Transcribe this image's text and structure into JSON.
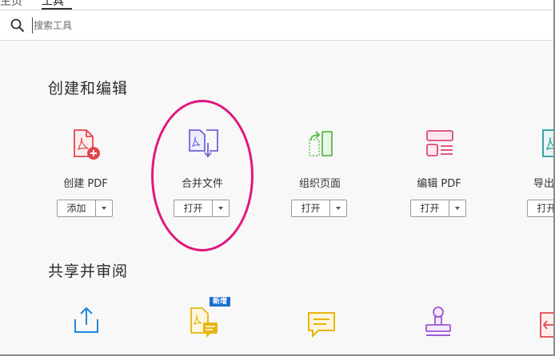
{
  "tabs": [
    {
      "label": "主页"
    },
    {
      "label": "工具"
    }
  ],
  "search": {
    "placeholder": "搜索工具"
  },
  "sections": {
    "create_edit": {
      "title": "创建和编辑"
    },
    "share_review": {
      "title": "共享并审阅"
    }
  },
  "tools": {
    "create_pdf": {
      "label": "创建 PDF",
      "button": "添加",
      "icon": "create-pdf-icon",
      "color": "#e0474c"
    },
    "combine_files": {
      "label": "合并文件",
      "button": "打开",
      "icon": "combine-files-icon",
      "color": "#6f63d9"
    },
    "organize_pages": {
      "label": "组织页面",
      "button": "打开",
      "icon": "organize-pages-icon",
      "color": "#57b947"
    },
    "edit_pdf": {
      "label": "编辑 PDF",
      "button": "打开",
      "icon": "edit-pdf-icon",
      "color": "#e0456f"
    },
    "export_pdf": {
      "label": "导出",
      "button": "打开",
      "icon": "export-pdf-icon",
      "color": "#1f9e9a"
    }
  },
  "share_tools": {
    "share": {
      "icon": "share-upload-icon",
      "color": "#1f86d8"
    },
    "send_comments": {
      "icon": "comment-document-icon",
      "color": "#e6b510",
      "badge": "新增"
    },
    "comment": {
      "icon": "comment-icon",
      "color": "#e6b510"
    },
    "stamp": {
      "icon": "stamp-icon",
      "color": "#9f57d6"
    },
    "send_track": {
      "icon": "send-track-icon",
      "color": "#e0474c"
    }
  },
  "annotation": {
    "color": "#e0177f"
  }
}
